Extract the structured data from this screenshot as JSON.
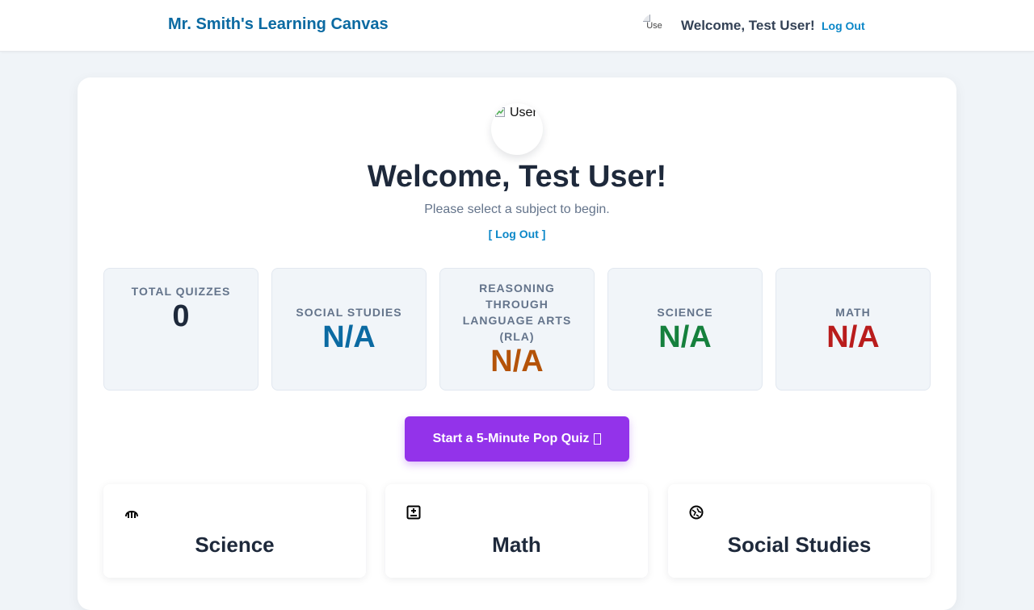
{
  "header": {
    "brand": "Mr. Smith's Learning Canvas",
    "avatar_alt": "Use",
    "welcome": "Welcome, Test User!",
    "logout": "Log Out"
  },
  "profile": {
    "avatar_alt": "User",
    "title": "Welcome, Test User!",
    "subtitle": "Please select a subject to begin.",
    "logout_link": "[ Log Out ]"
  },
  "stats": [
    {
      "label": "Total Quizzes",
      "value": "0",
      "color": "#1e293b"
    },
    {
      "label": "Social Studies",
      "value": "N/A",
      "color": "#0b6aa2"
    },
    {
      "label": "Reasoning Through Language Arts (RLA)",
      "value": "N/A",
      "color": "#b45309"
    },
    {
      "label": "Science",
      "value": "N/A",
      "color": "#15803d"
    },
    {
      "label": "Math",
      "value": "N/A",
      "color": "#b91c1c"
    }
  ],
  "pop_quiz": {
    "label": "Start a 5-Minute Pop Quiz"
  },
  "subjects": [
    {
      "name": "Science",
      "icon": "microscope-icon"
    },
    {
      "name": "Math",
      "icon": "calculator-icon"
    },
    {
      "name": "Social Studies",
      "icon": "globe-icon"
    }
  ],
  "colors": {
    "brand": "#0b6aa2",
    "accent_link": "#0b87c8",
    "quiz_button": "#9333ea",
    "page_bg": "#f0f4f8"
  }
}
